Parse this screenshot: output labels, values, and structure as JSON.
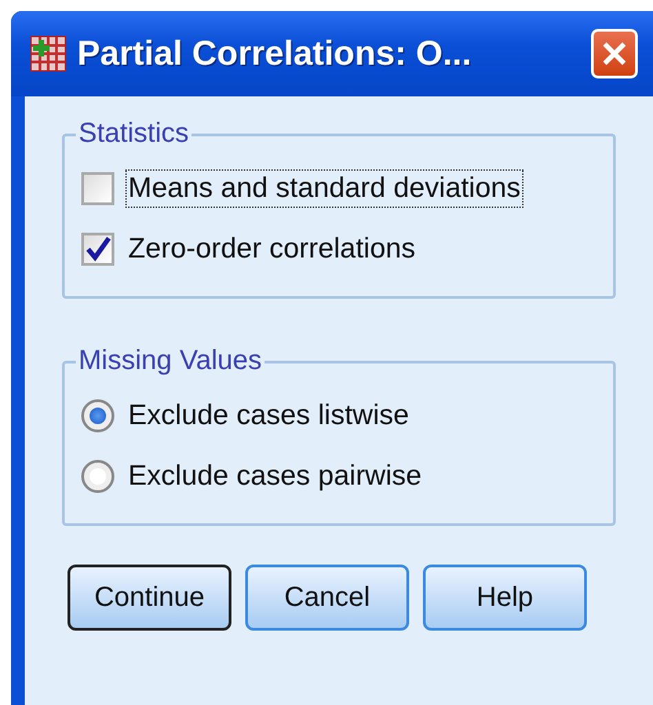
{
  "window": {
    "title": "Partial Correlations: O..."
  },
  "statistics": {
    "legend": "Statistics",
    "options": [
      {
        "label": "Means and standard deviations",
        "checked": false,
        "focused": true
      },
      {
        "label": "Zero-order correlations",
        "checked": true,
        "focused": false
      }
    ]
  },
  "missing_values": {
    "legend": "Missing Values",
    "options": [
      {
        "label": "Exclude cases listwise",
        "selected": true
      },
      {
        "label": "Exclude cases pairwise",
        "selected": false
      }
    ]
  },
  "buttons": [
    {
      "label": "Continue",
      "default": true
    },
    {
      "label": "Cancel",
      "default": false
    },
    {
      "label": "Help",
      "default": false
    }
  ]
}
